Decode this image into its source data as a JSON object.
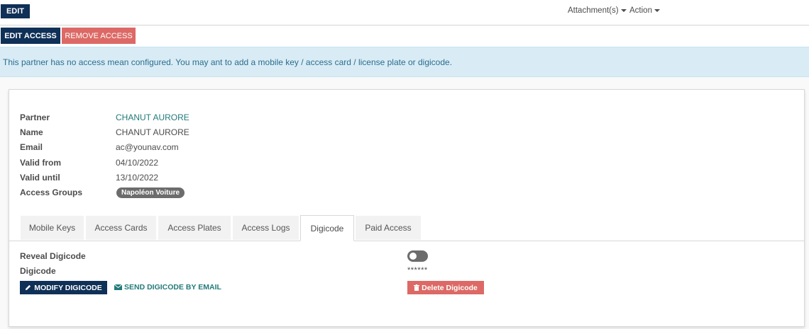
{
  "topbar": {
    "edit_label": "EDIT",
    "attachments_label": "Attachment(s)",
    "action_label": "Action"
  },
  "actionbar": {
    "edit_access_label": "EDIT ACCESS",
    "remove_access_label": "REMOVE ACCESS"
  },
  "alert": {
    "text": "This partner has no access mean configured. You may ant to add a mobile key / access card / license plate or digicode."
  },
  "form": {
    "fields": [
      {
        "label": "Partner",
        "value": "CHANUT AURORE"
      },
      {
        "label": "Name",
        "value": "CHANUT AURORE"
      },
      {
        "label": "Email",
        "value": "ac@younav.com"
      },
      {
        "label": "Valid from",
        "value": "04/10/2022"
      },
      {
        "label": "Valid until",
        "value": "13/10/2022"
      },
      {
        "label": "Access Groups",
        "value": "Napoléon Voiture"
      }
    ]
  },
  "tabs": [
    {
      "label": "Mobile Keys"
    },
    {
      "label": "Access Cards"
    },
    {
      "label": "Access Plates"
    },
    {
      "label": "Access Logs"
    },
    {
      "label": "Digicode"
    },
    {
      "label": "Paid Access"
    }
  ],
  "active_tab": "Digicode",
  "digicode": {
    "reveal_label": "Reveal Digicode",
    "reveal_on": false,
    "digicode_label": "Digicode",
    "digicode_value": "******",
    "modify_label": "MODIFY DIGICODE",
    "send_label": "SEND DIGICODE BY EMAIL",
    "delete_label": "Delete Digicode"
  },
  "colors": {
    "primary": "#0f3057",
    "danger": "#dc6965",
    "link": "#237a7a",
    "alert_bg": "#d9ecf5"
  }
}
